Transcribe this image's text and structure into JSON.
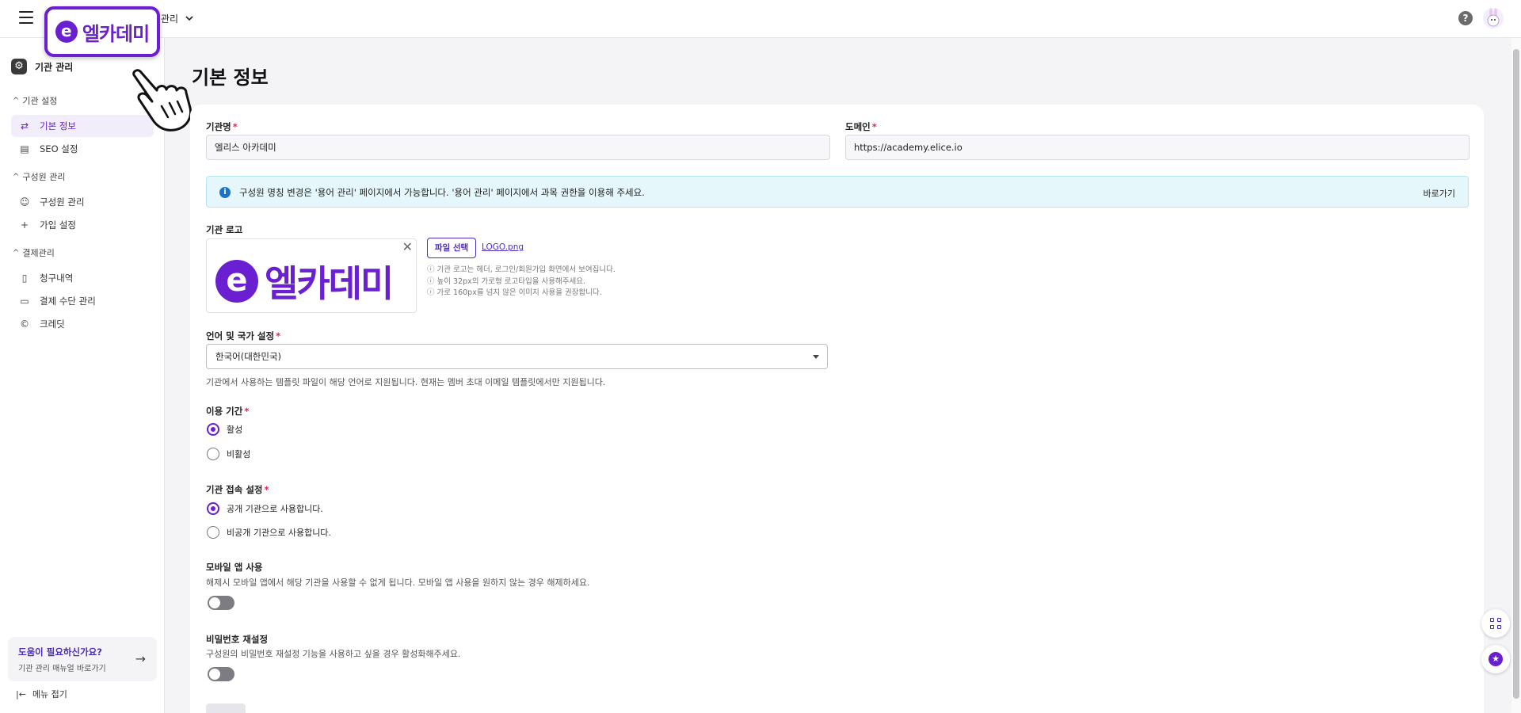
{
  "header": {
    "org_name": "관리",
    "help_label": "?"
  },
  "brand": {
    "logo_letter": "e",
    "logo_text": "엘카데미",
    "color": "#6a1fd1"
  },
  "sidebar": {
    "top_label": "기관 관리",
    "sections": [
      {
        "title": "기관 설정",
        "items": [
          {
            "label": "기본 정보",
            "icon": "swap-arrows-icon",
            "active": true
          },
          {
            "label": "SEO 설정",
            "icon": "seo-chart-icon",
            "active": false
          }
        ]
      },
      {
        "title": "구성원 관리",
        "items": [
          {
            "label": "구성원 관리",
            "icon": "users-icon",
            "active": false
          },
          {
            "label": "가입 설정",
            "icon": "user-plus-icon",
            "active": false
          }
        ]
      },
      {
        "title": "결제관리",
        "items": [
          {
            "label": "청구내역",
            "icon": "receipt-icon",
            "active": false
          },
          {
            "label": "결제 수단 관리",
            "icon": "credit-card-icon",
            "active": false
          },
          {
            "label": "크레딧",
            "icon": "credit-coin-icon",
            "active": false
          }
        ]
      }
    ],
    "help_card": {
      "title": "도움이 필요하신가요?",
      "subtitle": "기관 관리 매뉴얼 바로가기"
    },
    "collapse_label": "메뉴 접기"
  },
  "main": {
    "title": "기본 정보",
    "org_field": {
      "label": "기관명",
      "value": "엘리스 아카데미"
    },
    "domain_field": {
      "label": "도메인",
      "value": "https://academy.elice.io"
    },
    "info": {
      "text": "구성원 명칭 변경은 '용어 관리' 페이지에서 가능합니다. '용어 관리' 페이지에서 과목 권한을 이용해 주세요.",
      "link": "바로가기"
    },
    "logo": {
      "label": "기관 로고",
      "file_button": "파일 선택",
      "file_name": "LOGO.png",
      "hints": [
        "기관 로고는 헤더, 로그인/회원가입 화면에서 보여집니다.",
        "높이 32px의 가로형 로고타입을 사용해주세요.",
        "가로 160px를 넘지 않은 이미지 사용을 권장합니다."
      ]
    },
    "language": {
      "label": "언어 및 국가 설정",
      "selected": "한국어(대한민국)",
      "description": "기관에서 사용하는 템플릿 파일이 해당 언어로 지원됩니다. 현재는 멤버 초대 이메일 템플릿에서만 지원됩니다."
    },
    "period": {
      "label": "이용 기간",
      "options": [
        "활성",
        "비활성"
      ],
      "selected": 0
    },
    "access": {
      "label": "기관 접속 설정",
      "options": [
        "공개 기관으로 사용합니다.",
        "비공개 기관으로 사용합니다."
      ],
      "selected": 0
    },
    "mobile": {
      "label": "모바일 앱 사용",
      "description": "해제시 모바일 앱에서 해당 기관을 사용할 수 없게 됩니다. 모바일 앱 사용을 원하지 않는 경우 해제하세요.",
      "enabled": false
    },
    "password_reset": {
      "label": "비밀번호 재설정",
      "description": "구성원의 비밀번호 재설정 기능을 사용하고 싶을 경우 활성화해주세요.",
      "enabled": false
    },
    "required_mark": "*"
  }
}
